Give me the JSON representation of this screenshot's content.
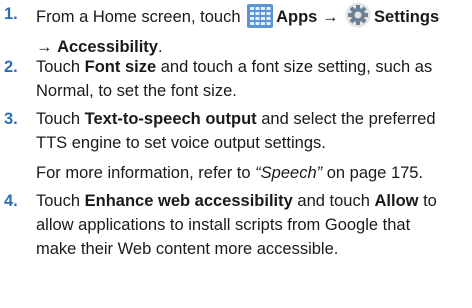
{
  "steps": [
    {
      "number": "1.",
      "lines": [
        {
          "text_1": "From a Home screen, touch",
          "apps_icon": "apps-grid-icon",
          "apps": "Apps",
          "arrow_1": "→",
          "settings_icon": "settings-gear-icon",
          "settings": "Settings"
        },
        {
          "arrow_2": "→",
          "accessibility": "Accessibility",
          "end": "."
        }
      ]
    },
    {
      "number": "2.",
      "lines": [
        {
          "touch": "Touch",
          "bold": "Font size",
          "rest": "and touch a font size setting, such as"
        },
        {
          "text": "Normal, to set the font size."
        }
      ]
    },
    {
      "number": "3.",
      "lines": [
        {
          "touch": "Touch",
          "bold": "Text-to-speech output",
          "rest": "and select the preferred"
        },
        {
          "text": "TTS engine to set voice output settings."
        },
        {
          "pre": "For more information, refer to",
          "ref": "“Speech”",
          "post": "on page 175."
        }
      ]
    },
    {
      "number": "4.",
      "lines": [
        {
          "touch": "Touch",
          "bold_1": "Enhance web accessibility",
          "mid": "and touch",
          "bold_2": "Allow",
          "end": "to"
        },
        {
          "text": "allow applications to install scripts from Google that"
        },
        {
          "text": "make their Web content more accessible."
        }
      ]
    }
  ]
}
